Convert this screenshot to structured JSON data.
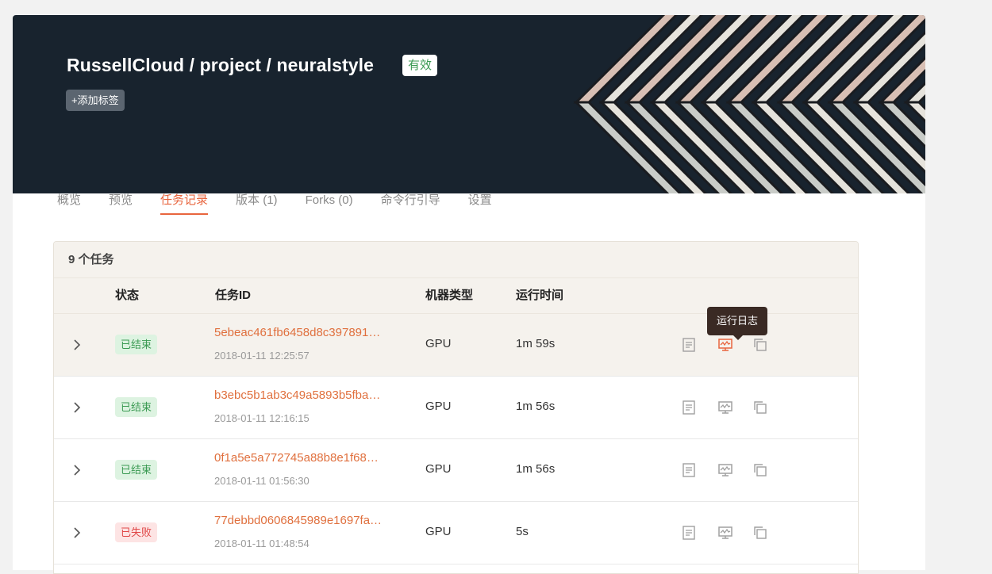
{
  "header": {
    "title": "RussellCloud / project / neuralstyle",
    "status_badge": "有效",
    "add_tag_label": "+添加标签"
  },
  "tabs": [
    {
      "label": "概览",
      "active": false
    },
    {
      "label": "预览",
      "active": false
    },
    {
      "label": "任务记录",
      "active": true
    },
    {
      "label": "版本 (1)",
      "active": false
    },
    {
      "label": "Forks (0)",
      "active": false
    },
    {
      "label": "命令行引导",
      "active": false
    },
    {
      "label": "设置",
      "active": false
    }
  ],
  "tasks": {
    "count_label": "9 个任务",
    "columns": [
      "状态",
      "任务ID",
      "机器类型",
      "运行时间"
    ],
    "rows": [
      {
        "status": "已结束",
        "status_kind": "ok",
        "id": "5ebeac461fb6458d8c397891…",
        "time": "2018-01-11 12:25:57",
        "machine": "GPU",
        "runtime": "1m 59s",
        "highlight": true
      },
      {
        "status": "已结束",
        "status_kind": "ok",
        "id": "b3ebc5b1ab3c49a5893b5fba…",
        "time": "2018-01-11 12:16:15",
        "machine": "GPU",
        "runtime": "1m 56s",
        "highlight": false
      },
      {
        "status": "已结束",
        "status_kind": "ok",
        "id": "0f1a5e5a772745a88b8e1f68…",
        "time": "2018-01-11 01:56:30",
        "machine": "GPU",
        "runtime": "1m 56s",
        "highlight": false
      },
      {
        "status": "已失败",
        "status_kind": "fail",
        "id": "77debbd0606845989e1697fa…",
        "time": "2018-01-11 01:48:54",
        "machine": "GPU",
        "runtime": "5s",
        "highlight": false
      }
    ],
    "row_actions": [
      "document-icon",
      "monitor-log-icon",
      "copy-icon"
    ]
  },
  "tooltip": {
    "text": "运行日志"
  },
  "colors": {
    "accent": "#e8653e",
    "hero_bg": "#18232e",
    "success": "#3a9a52",
    "danger": "#e04848",
    "icon_gray": "#a0a0a0"
  }
}
